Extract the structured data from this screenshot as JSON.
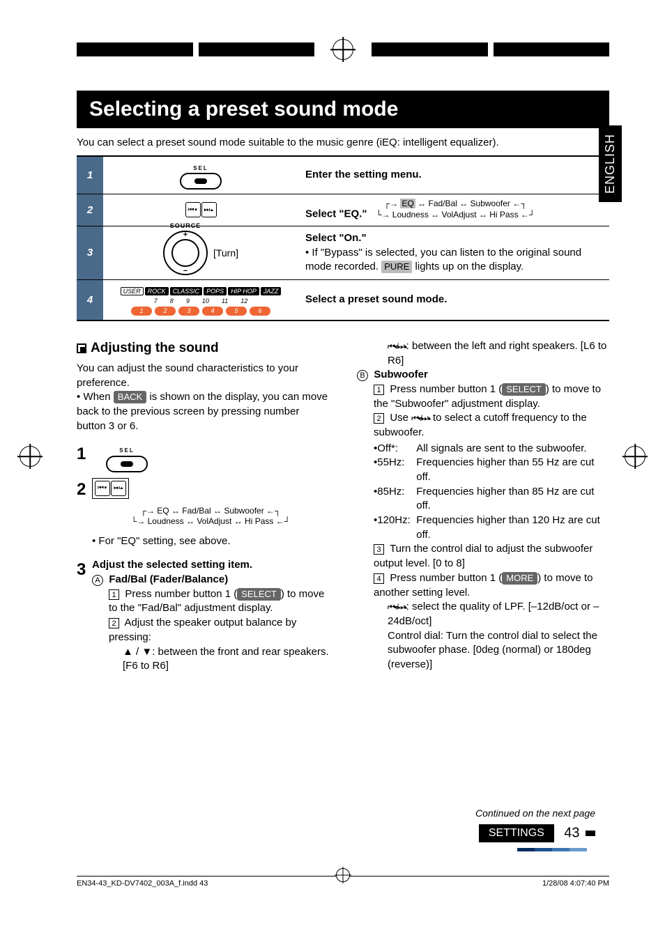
{
  "lang_tab": "ENGLISH",
  "title": "Selecting a preset sound mode",
  "intro": "You can select a preset sound mode suitable to the music genre (iEQ: intelligent equalizer).",
  "steps": {
    "s1": {
      "num": "1",
      "desc": "Enter the setting menu."
    },
    "s2": {
      "num": "2",
      "desc_bold": "Select \"EQ.\"",
      "flow1": "EQ",
      "flow2": "Fad/Bal",
      "flow3": "Subwoofer",
      "flow4": "Loudness",
      "flow5": "VolAdjust",
      "flow6": "Hi Pass"
    },
    "s3": {
      "num": "3",
      "source": "SOURCE",
      "turn": "[Turn]",
      "desc_bold": "Select \"On.\"",
      "bullet": "If \"Bypass\" is selected, you can listen to the original sound mode recorded.",
      "pure": "PURE",
      "bullet_tail": "lights up on the display."
    },
    "s4": {
      "num": "4",
      "presets": [
        "USER",
        "ROCK",
        "CLASSIC",
        "POPS",
        "HIP HOP",
        "JAZZ"
      ],
      "nums_top": [
        "7",
        "8",
        "9",
        "10",
        "11",
        "12"
      ],
      "nums_pill": [
        "1",
        "2",
        "3",
        "4",
        "5",
        "6"
      ],
      "desc": "Select a preset sound mode."
    }
  },
  "adjusting": {
    "heading": "Adjusting the sound",
    "p1": "You can adjust the sound characteristics to your preference.",
    "p2_pre": "When",
    "back_label": "BACK",
    "p2_post": "is shown on the display, you can move back to the previous screen by pressing number button 3 or 6.",
    "step1": "1",
    "step2": "2",
    "flow1": "EQ",
    "flow2": "Fad/Bal",
    "flow3": "Subwoofer",
    "flow4": "Loudness",
    "flow5": "VolAdjust",
    "flow6": "Hi Pass",
    "for_eq": "For \"EQ\" setting, see above.",
    "step3": "3",
    "step3_title": "Adjust the selected setting item.",
    "A": "A",
    "A_title": "Fad/Bal (Fader/Balance)",
    "A1_num": "1",
    "A1_pre": "Press number button 1 (",
    "select_label": "SELECT",
    "A1_post": ") to move to the \"Fad/Bal\" adjustment display.",
    "A2_num": "2",
    "A2": "Adjust the speaker output balance by pressing:",
    "A2_fr": "▲ / ▼: between the front and rear speakers. [F6 to R6]",
    "A2_lr": ": between the left and right speakers. [L6 to R6]",
    "B": "B",
    "B_title": "Subwoofer",
    "B1_num": "1",
    "B1_pre": "Press number button 1 (",
    "B1_post": ") to move to the \"Subwoofer\" adjustment display.",
    "B2_num": "2",
    "B2_pre": "Use ",
    "B2_post": " to select a cutoff frequency to the subwoofer.",
    "B2_off_k": "Off*:",
    "B2_off_v": "All signals are sent to the subwoofer.",
    "B2_55_k": "55Hz:",
    "B2_55_v": "Frequencies higher than 55 Hz are cut off.",
    "B2_85_k": "85Hz:",
    "B2_85_v": "Frequencies higher than 85 Hz are cut off.",
    "B2_120_k": "120Hz:",
    "B2_120_v": "Frequencies higher than 120 Hz are cut off.",
    "B3_num": "3",
    "B3": "Turn the control dial to adjust the subwoofer output level. [0 to 8]",
    "B4_num": "4",
    "B4_pre": "Press number button 1 (",
    "more_label": "MORE",
    "B4_post": ") to move to another setting level.",
    "B4_lpf": ": select the quality of LPF. [–12dB/oct or –24dB/oct]",
    "B4_ctrl": "Control dial: Turn the control dial to select the subwoofer phase. [0deg (normal) or 180deg (reverse)]"
  },
  "continued": "Continued on the next page",
  "section": "SETTINGS",
  "page_num": "43",
  "footer_file": "EN34-43_KD-DV7402_003A_f.indd   43",
  "footer_time": "1/28/08   4:07:40 PM"
}
